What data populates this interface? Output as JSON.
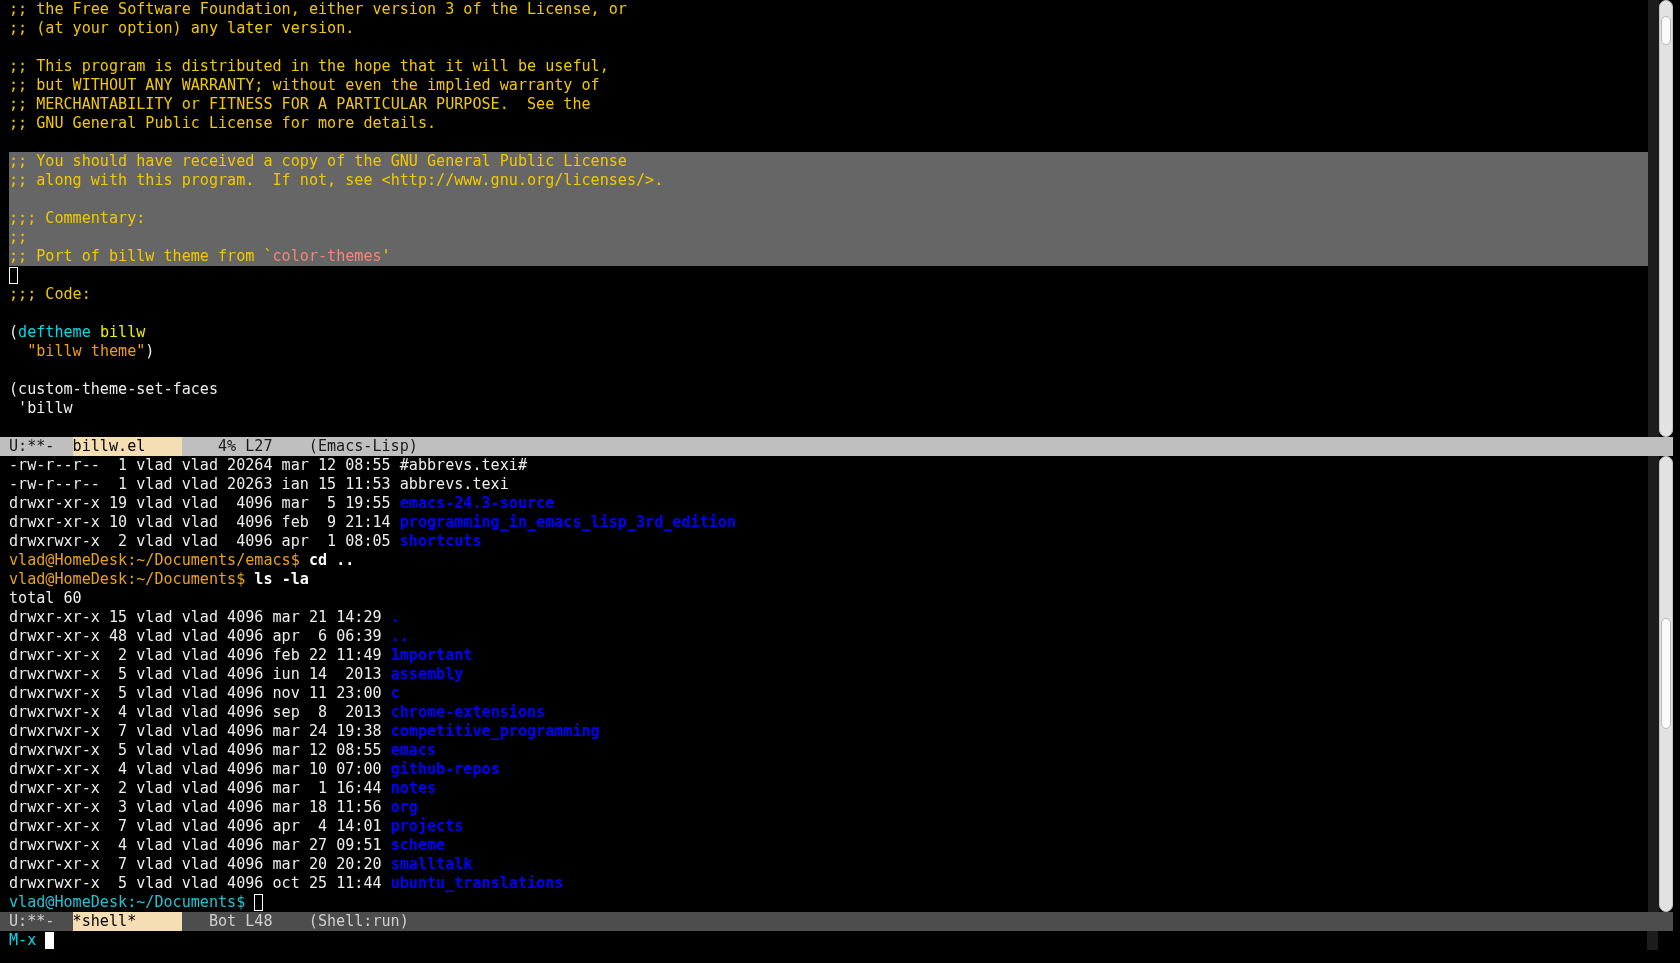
{
  "windows": [
    {
      "lines": [
        {
          "selected": false,
          "segments": [
            {
              "kind": "comment",
              "text": ";; the Free Software Foundation, either version 3 of the License, or"
            }
          ]
        },
        {
          "selected": false,
          "segments": [
            {
              "kind": "comment",
              "text": ";; (at your option) any later version."
            }
          ]
        },
        {
          "selected": false
        },
        {
          "selected": false,
          "segments": [
            {
              "kind": "comment",
              "text": ";; This program is distributed in the hope that it will be useful,"
            }
          ]
        },
        {
          "selected": false,
          "segments": [
            {
              "kind": "comment",
              "text": ";; but WITHOUT ANY WARRANTY; without even the implied warranty of"
            }
          ]
        },
        {
          "selected": false,
          "segments": [
            {
              "kind": "comment",
              "text": ";; MERCHANTABILITY or FITNESS FOR A PARTICULAR PURPOSE.  See the"
            }
          ]
        },
        {
          "selected": false,
          "segments": [
            {
              "kind": "comment",
              "text": ";; GNU General Public License for more details."
            }
          ]
        },
        {
          "selected": false
        },
        {
          "selected": true,
          "segments": [
            {
              "kind": "comment",
              "text": ";; You should have received a copy of the GNU General Public License"
            }
          ]
        },
        {
          "selected": true,
          "segments": [
            {
              "kind": "comment",
              "text": ";; along with this program.  If not, see <http://www.gnu.org/licenses/>."
            }
          ]
        },
        {
          "selected": true
        },
        {
          "selected": true,
          "segments": [
            {
              "kind": "comment",
              "text": ";;; Commentary:"
            }
          ]
        },
        {
          "selected": true,
          "segments": [
            {
              "kind": "comment",
              "text": ";;"
            }
          ]
        },
        {
          "selected": true,
          "segments": [
            {
              "kind": "comment",
              "text": ";; Port of billw theme from `"
            },
            {
              "kind": "constant",
              "text": "color-themes"
            },
            {
              "kind": "comment",
              "text": "'"
            }
          ]
        },
        {
          "selected": false,
          "segments": [
            {
              "kind": "cursor"
            }
          ]
        },
        {
          "selected": false,
          "segments": [
            {
              "kind": "comment",
              "text": ";;; Code:"
            }
          ]
        },
        {
          "selected": false
        },
        {
          "selected": false,
          "segments": [
            {
              "kind": "default",
              "text": "("
            },
            {
              "kind": "keyword",
              "text": "deftheme"
            },
            {
              "kind": "function",
              "text": " billw"
            }
          ]
        },
        {
          "selected": false,
          "segments": [
            {
              "kind": "string",
              "text": "  \"billw theme\""
            },
            {
              "kind": "default",
              "text": ")"
            }
          ]
        },
        {
          "selected": false
        },
        {
          "selected": false,
          "segments": [
            {
              "kind": "default",
              "text": "(custom-theme-set-faces"
            }
          ]
        },
        {
          "selected": false,
          "segments": [
            {
              "kind": "default",
              "text": " 'billw"
            }
          ]
        },
        {
          "selected": false
        }
      ],
      "mode_line": {
        "active": true,
        "status": "U:**-",
        "buffer": "billw.el",
        "percent": "4%",
        "line": "L27",
        "mode": "(Emacs-Lisp)"
      }
    },
    {
      "lines": [
        {
          "segments": [
            {
              "kind": "default",
              "text": "-rw-r--r--  1 vlad vlad 20264 mar 12 08:55 #abbrevs.texi#"
            }
          ]
        },
        {
          "segments": [
            {
              "kind": "default",
              "text": "-rw-r--r--  1 vlad vlad 20263 ian 15 11:53 abbrevs.texi"
            }
          ]
        },
        {
          "segments": [
            {
              "kind": "default",
              "text": "drwxr-xr-x 19 vlad vlad  4096 mar  5 19:55 "
            },
            {
              "kind": "dir",
              "text": "emacs-24.3-source"
            }
          ]
        },
        {
          "segments": [
            {
              "kind": "default",
              "text": "drwxr-xr-x 10 vlad vlad  4096 feb  9 21:14 "
            },
            {
              "kind": "dir",
              "text": "programming_in_emacs_lisp_3rd_edition"
            }
          ]
        },
        {
          "segments": [
            {
              "kind": "default",
              "text": "drwxrwxr-x  2 vlad vlad  4096 apr  1 08:05 "
            },
            {
              "kind": "dir",
              "text": "shortcuts"
            }
          ]
        },
        {
          "segments": [
            {
              "kind": "prompt",
              "text": "vlad@HomeDesk:~/Documents/emacs$"
            },
            {
              "kind": "input",
              "text": " cd .."
            }
          ]
        },
        {
          "segments": [
            {
              "kind": "prompt",
              "text": "vlad@HomeDesk:~/Documents$"
            },
            {
              "kind": "input",
              "text": " ls -la"
            }
          ]
        },
        {
          "segments": [
            {
              "kind": "default",
              "text": "total 60"
            }
          ]
        },
        {
          "segments": [
            {
              "kind": "default",
              "text": "drwxr-xr-x 15 vlad vlad 4096 mar 21 14:29 "
            },
            {
              "kind": "dir",
              "text": "."
            }
          ]
        },
        {
          "segments": [
            {
              "kind": "default",
              "text": "drwxr-xr-x 48 vlad vlad 4096 apr  6 06:39 "
            },
            {
              "kind": "dir",
              "text": ".."
            }
          ]
        },
        {
          "segments": [
            {
              "kind": "default",
              "text": "drwxr-xr-x  2 vlad vlad 4096 feb 22 11:49 "
            },
            {
              "kind": "dir",
              "text": "1mportant"
            }
          ]
        },
        {
          "segments": [
            {
              "kind": "default",
              "text": "drwxrwxr-x  5 vlad vlad 4096 iun 14  2013 "
            },
            {
              "kind": "dir",
              "text": "assembly"
            }
          ]
        },
        {
          "segments": [
            {
              "kind": "default",
              "text": "drwxrwxr-x  5 vlad vlad 4096 nov 11 23:00 "
            },
            {
              "kind": "dir",
              "text": "c"
            }
          ]
        },
        {
          "segments": [
            {
              "kind": "default",
              "text": "drwxrwxr-x  4 vlad vlad 4096 sep  8  2013 "
            },
            {
              "kind": "dir",
              "text": "chrome-extensions"
            }
          ]
        },
        {
          "segments": [
            {
              "kind": "default",
              "text": "drwxrwxr-x  7 vlad vlad 4096 mar 24 19:38 "
            },
            {
              "kind": "dir",
              "text": "competitive_programming"
            }
          ]
        },
        {
          "segments": [
            {
              "kind": "default",
              "text": "drwxrwxr-x  5 vlad vlad 4096 mar 12 08:55 "
            },
            {
              "kind": "dir",
              "text": "emacs"
            }
          ]
        },
        {
          "segments": [
            {
              "kind": "default",
              "text": "drwxr-xr-x  4 vlad vlad 4096 mar 10 07:00 "
            },
            {
              "kind": "dir",
              "text": "github-repos"
            }
          ]
        },
        {
          "segments": [
            {
              "kind": "default",
              "text": "drwxr-xr-x  2 vlad vlad 4096 mar  1 16:44 "
            },
            {
              "kind": "dir",
              "text": "notes"
            }
          ]
        },
        {
          "segments": [
            {
              "kind": "default",
              "text": "drwxr-xr-x  3 vlad vlad 4096 mar 18 11:56 "
            },
            {
              "kind": "dir",
              "text": "org"
            }
          ]
        },
        {
          "segments": [
            {
              "kind": "default",
              "text": "drwxr-xr-x  7 vlad vlad 4096 apr  4 14:01 "
            },
            {
              "kind": "dir",
              "text": "projects"
            }
          ]
        },
        {
          "segments": [
            {
              "kind": "default",
              "text": "drwxrwxr-x  4 vlad vlad 4096 mar 27 09:51 "
            },
            {
              "kind": "dir",
              "text": "scheme"
            }
          ]
        },
        {
          "segments": [
            {
              "kind": "default",
              "text": "drwxr-xr-x  7 vlad vlad 4096 mar 20 20:20 "
            },
            {
              "kind": "dir",
              "text": "smalltalk"
            }
          ]
        },
        {
          "segments": [
            {
              "kind": "default",
              "text": "drwxrwxr-x  5 vlad vlad 4096 oct 25 11:44 "
            },
            {
              "kind": "dir",
              "text": "ubuntu_translations"
            }
          ]
        },
        {
          "segments": [
            {
              "kind": "current",
              "text": "vlad@HomeDesk:~/Documents$ "
            },
            {
              "kind": "cursor"
            }
          ]
        }
      ],
      "mode_line": {
        "active": false,
        "status": "U:**-",
        "buffer": "*shell*",
        "percent": "Bot",
        "line": "L48",
        "mode": "(Shell:run)"
      }
    }
  ],
  "minibuffer": {
    "prompt": "M-x ",
    "cursor": true
  }
}
